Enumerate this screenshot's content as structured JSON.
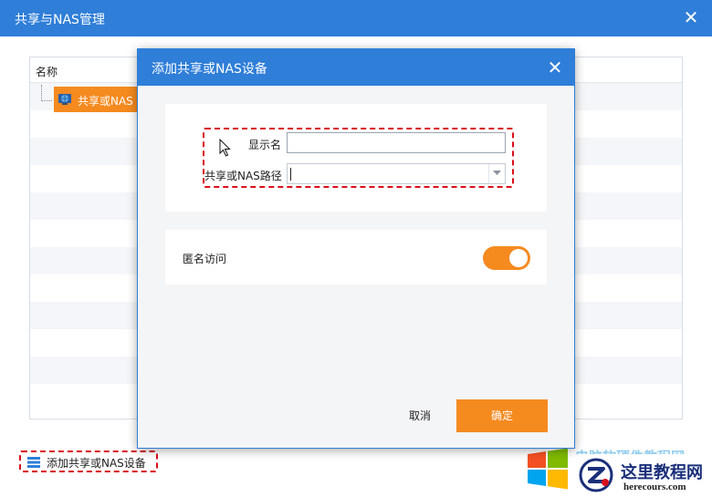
{
  "window": {
    "title": "共享与NAS管理",
    "close_icon": "close-icon"
  },
  "list": {
    "column_header": "名称",
    "items": [
      {
        "label": "共享或NAS",
        "icon": "nas-globe-icon",
        "selected": true
      }
    ]
  },
  "footer": {
    "add_device_label": "添加共享或NAS设备",
    "add_device_icon": "server-stack-icon"
  },
  "dialog": {
    "title": "添加共享或NAS设备",
    "close_icon": "close-icon",
    "display_name": {
      "label": "显示名",
      "value": ""
    },
    "path": {
      "label": "共享或NAS路径",
      "value": ""
    },
    "anonymous": {
      "label": "匿名访问",
      "enabled": true
    },
    "cancel_label": "取消",
    "ok_label": "确定"
  },
  "watermark": {
    "partial_text": "电脑软硬件教程网",
    "badge_title": "这里教程网",
    "badge_url": "herecours.com"
  },
  "colors": {
    "titlebar": "#2f7ed8",
    "accent": "#f58a1f",
    "highlight": "#d8101c"
  }
}
